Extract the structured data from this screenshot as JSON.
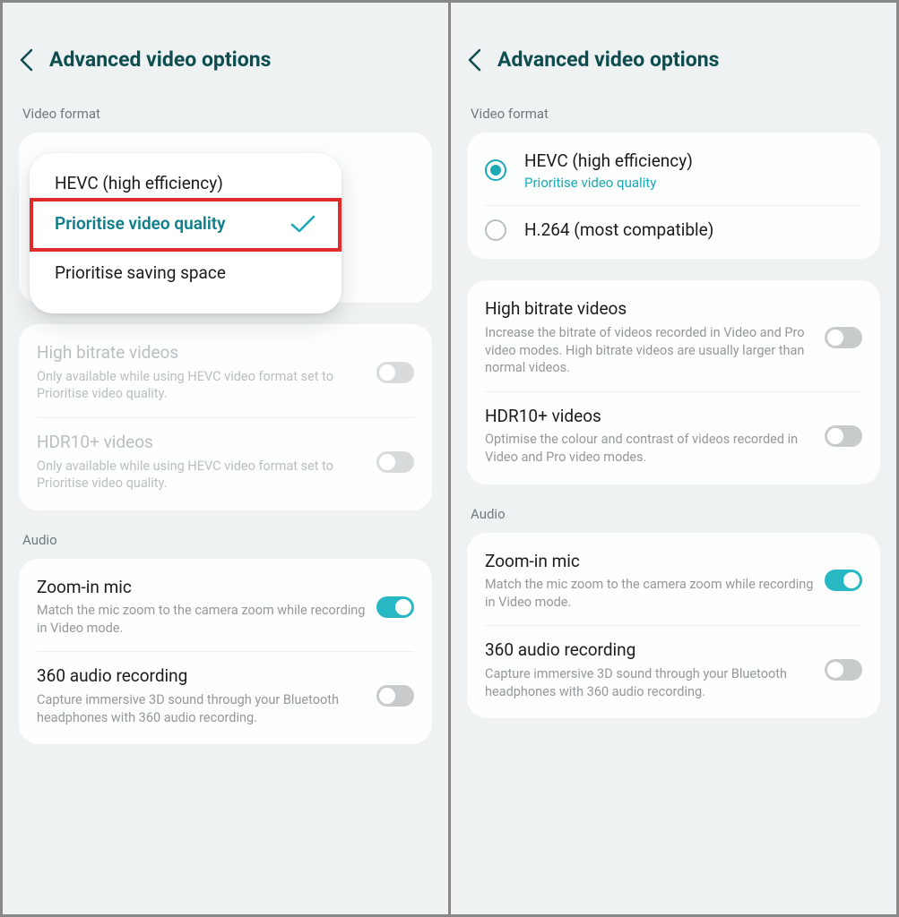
{
  "left": {
    "title": "Advanced video options",
    "section_video": "Video format",
    "popup": {
      "title": "HEVC (high efficiency)",
      "item_selected": "Prioritise video quality",
      "item_other": "Prioritise saving space"
    },
    "high_bitrate": {
      "title": "High bitrate videos",
      "desc": "Only available while using HEVC video format set to Prioritise video quality."
    },
    "hdr10": {
      "title": "HDR10+ videos",
      "desc": "Only available while using HEVC video format set to Prioritise video quality."
    },
    "section_audio": "Audio",
    "zoom_mic": {
      "title": "Zoom-in mic",
      "desc": "Match the mic zoom to the camera zoom while recording in Video mode."
    },
    "audio360": {
      "title": "360 audio recording",
      "desc": "Capture immersive 3D sound through your Bluetooth headphones with 360 audio recording."
    }
  },
  "right": {
    "title": "Advanced video options",
    "section_video": "Video format",
    "hevc": {
      "title": "HEVC (high efficiency)",
      "subtitle": "Prioritise video quality"
    },
    "h264": {
      "title": "H.264 (most compatible)"
    },
    "high_bitrate": {
      "title": "High bitrate videos",
      "desc": "Increase the bitrate of videos recorded in Video and Pro video modes. High bitrate videos are usually larger than normal videos."
    },
    "hdr10": {
      "title": "HDR10+ videos",
      "desc": "Optimise the colour and contrast of videos recorded in Video and Pro video modes."
    },
    "section_audio": "Audio",
    "zoom_mic": {
      "title": "Zoom-in mic",
      "desc": "Match the mic zoom to the camera zoom while recording in Video mode."
    },
    "audio360": {
      "title": "360 audio recording",
      "desc": "Capture immersive 3D sound through your Bluetooth headphones with 360 audio recording."
    }
  }
}
